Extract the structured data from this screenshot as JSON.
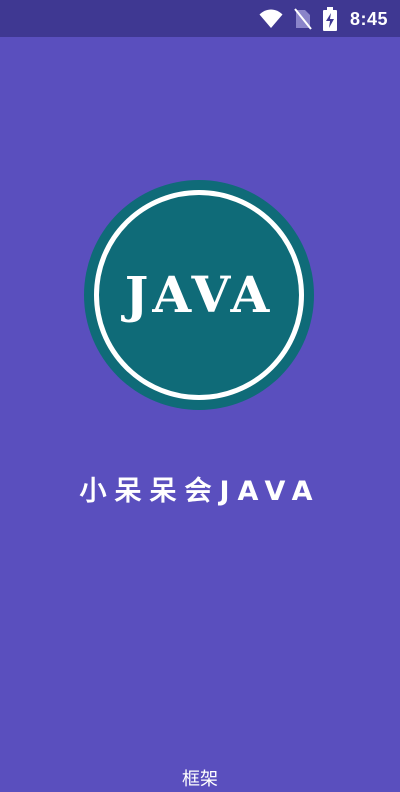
{
  "status_bar": {
    "time": "8:45",
    "icons": [
      "wifi-icon",
      "no-sim-icon",
      "battery-charging-icon"
    ]
  },
  "splash": {
    "logo_text": "JAVA",
    "app_name": "小呆呆会JAVA",
    "footer_label": "框架"
  },
  "colors": {
    "background": "#5a4fbe",
    "status_bar": "#3f3892",
    "logo_fill": "#0f6b78",
    "logo_ring": "#ffffff",
    "text": "#ffffff"
  }
}
